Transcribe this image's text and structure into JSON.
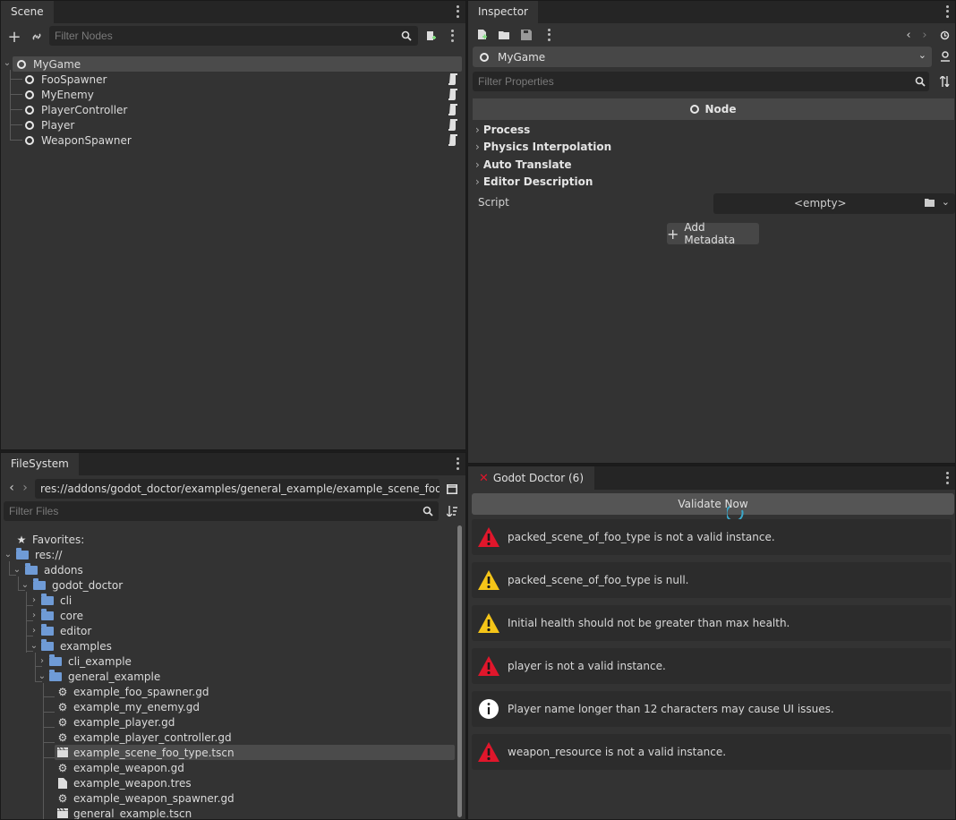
{
  "scene": {
    "tab": "Scene",
    "filter_placeholder": "Filter Nodes",
    "nodes": [
      {
        "label": "MyGame",
        "root": true
      },
      {
        "label": "FooSpawner"
      },
      {
        "label": "MyEnemy"
      },
      {
        "label": "PlayerController"
      },
      {
        "label": "Player"
      },
      {
        "label": "WeaponSpawner"
      }
    ]
  },
  "inspector": {
    "tab": "Inspector",
    "node_select": "MyGame",
    "filter_placeholder": "Filter Properties",
    "class_header": "Node",
    "sections": [
      "Process",
      "Physics Interpolation",
      "Auto Translate",
      "Editor Description"
    ],
    "script_label": "Script",
    "script_value": "<empty>",
    "add_metadata": "Add Metadata"
  },
  "filesystem": {
    "tab": "FileSystem",
    "path": "res://addons/godot_doctor/examples/general_example/example_scene_foo_type.tscn",
    "filter_placeholder": "Filter Files",
    "items": [
      {
        "label": "Favorites:",
        "type": "star"
      },
      {
        "label": "res://",
        "type": "folder"
      },
      {
        "label": "addons",
        "type": "folder"
      },
      {
        "label": "godot_doctor",
        "type": "folder"
      },
      {
        "label": "cli",
        "type": "folder"
      },
      {
        "label": "core",
        "type": "folder"
      },
      {
        "label": "editor",
        "type": "folder"
      },
      {
        "label": "examples",
        "type": "folder"
      },
      {
        "label": "cli_example",
        "type": "folder"
      },
      {
        "label": "general_example",
        "type": "folder"
      },
      {
        "label": "example_foo_spawner.gd",
        "type": "gear"
      },
      {
        "label": "example_my_enemy.gd",
        "type": "gear"
      },
      {
        "label": "example_player.gd",
        "type": "gear"
      },
      {
        "label": "example_player_controller.gd",
        "type": "gear"
      },
      {
        "label": "example_scene_foo_type.tscn",
        "type": "scene"
      },
      {
        "label": "example_weapon.gd",
        "type": "gear"
      },
      {
        "label": "example_weapon.tres",
        "type": "file"
      },
      {
        "label": "example_weapon_spawner.gd",
        "type": "gear"
      },
      {
        "label": "general_example.tscn",
        "type": "scene"
      }
    ]
  },
  "doctor": {
    "tab": "Godot Doctor (6)",
    "validate_label": "Validate Now",
    "diagnostics": [
      {
        "level": "error",
        "text": "packed_scene_of_foo_type is not a valid instance."
      },
      {
        "level": "warning",
        "text": "packed_scene_of_foo_type is null."
      },
      {
        "level": "warning",
        "text": "Initial health should not be greater than max health."
      },
      {
        "level": "error",
        "text": "player is not a valid instance."
      },
      {
        "level": "info",
        "text": "Player name longer than 12 characters may cause UI issues."
      },
      {
        "level": "error",
        "text": "weapon_resource is not a valid instance."
      }
    ]
  },
  "colors": {
    "error": "#e0162b",
    "warning": "#f5c518",
    "info": "#ffffff",
    "selection": "#4b4b4b",
    "folder": "#6f9bd6"
  }
}
